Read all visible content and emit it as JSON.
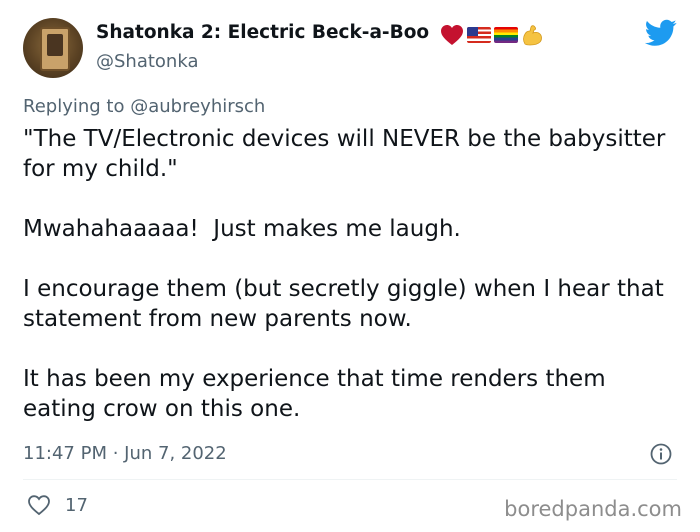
{
  "author": {
    "display_name": "Shatonka 2: Electric Beck-a-Boo",
    "handle": "@Shatonka",
    "badges": [
      "heart-emoji",
      "us-flag-emoji",
      "rainbow-flag-emoji",
      "flexed-biceps-emoji"
    ]
  },
  "reply": {
    "prefix": "Replying to",
    "mention": "@aubreyhirsch"
  },
  "tweet": {
    "paragraphs": [
      "\"The TV/Electronic devices will NEVER be the babysitter for my child.\"",
      "Mwahahaaaaa!  Just makes me laugh.",
      "I encourage them (but secretly giggle) when I hear that statement from new parents now.",
      "It has been my experience that time renders them eating crow on this one."
    ],
    "timestamp": "11:47 PM · Jun 7, 2022",
    "likes": "17"
  },
  "watermark": "boredpanda.com",
  "colors": {
    "twitter_blue": "#1d9bf0",
    "secondary_text": "#536471",
    "primary_text": "#0f1419",
    "heart_red": "#c4122f"
  }
}
